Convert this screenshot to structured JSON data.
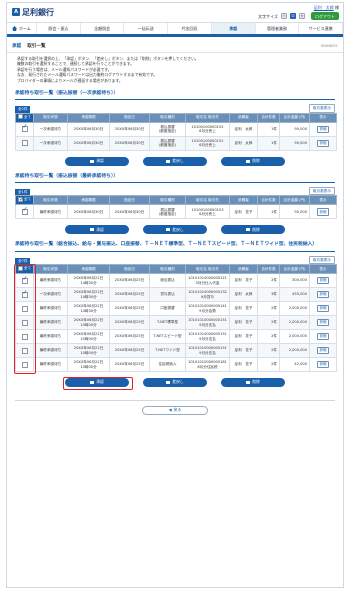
{
  "header": {
    "logo": "足利銀行",
    "user_prefix": "",
    "user_name": "足利　太郎",
    "user_suffix": "様",
    "last_login": "",
    "font_size_label": "文字サイズ",
    "font_size_options": [
      "小",
      "中",
      "大"
    ],
    "logout": "ログアウト"
  },
  "nav": {
    "home": "ホーム",
    "items": [
      "照会・振込",
      "全額照会",
      "一括伝送",
      "代金回収",
      "承認",
      "管理者業務",
      "サービス連携"
    ]
  },
  "page": {
    "title_section": "承認",
    "title": "取引一覧",
    "code": "BSHN001",
    "description": [
      "承認する取引を選択の上、「承認」ボタン、「差戻し」ボタン、または「削除」ボタンを押してください。",
      "複数の取引を選択することで、連続して承認を行うことができます。",
      "承認を行う場合は、メール通知パスワードが必要です。",
      "なお、発行されたメール通知パスワードは出力後約ログアウトするまで有効です。",
      "プロバイダーの事情によりメールが遅延する場合があります。"
    ]
  },
  "section1": {
    "title": "承認待ち取引一覧（振込振替（一次承認待ち））",
    "count": "全2件",
    "col_button": "取引数表示",
    "headers": [
      "全て",
      "取引状態",
      "承認期限",
      "指定日",
      "取引種別",
      "取引名\n取引先",
      "依頼者",
      "合計件数",
      "合計金額\n(円)",
      "表示"
    ],
    "rows": [
      {
        "checked": true,
        "status": "一次承認待ち",
        "deadline": "20XX年06月30日",
        "date": "20XX年06月30日",
        "type": "振込振替\n(都度指定)",
        "name": "10100100000152\n6月分売上",
        "requester": "足利　太郎",
        "count": "1件",
        "amount": "90,000",
        "detail": "詳細"
      },
      {
        "checked": false,
        "status": "一次承認待ち",
        "deadline": "20XX年06月30日",
        "date": "20XX年06月30日",
        "type": "振込振替\n(都度指定)",
        "name": "10100100000152\n6月分売上",
        "requester": "足利　太郎",
        "count": "1件",
        "amount": "90,000",
        "detail": "詳細"
      }
    ],
    "buttons": [
      "承認",
      "差戻し",
      "削除"
    ]
  },
  "section2": {
    "title": "承認待ち取引一覧（振込振替（最終承認待ち））",
    "count": "全1件",
    "col_button": "取引数表示",
    "headers": [
      "全て",
      "取引状態",
      "承認期限",
      "指定日",
      "取引種別",
      "取引名\n取引先",
      "依頼者",
      "合計件数",
      "合計金額\n(円)",
      "表示"
    ],
    "rows": [
      {
        "checked": true,
        "status": "最終承認待ち",
        "deadline": "20XX年06月30日",
        "date": "20XX年06月30日",
        "type": "振込振替\n(都度指定)",
        "name": "10100100000153\n6月分売上",
        "requester": "足利　花子",
        "count": "1件",
        "amount": "90,000",
        "detail": "詳細"
      }
    ],
    "buttons": [
      "承認",
      "差戻し",
      "削除"
    ]
  },
  "section3": {
    "title": "承認待ち取引一覧（総合振込、給与・賞与振込、口座振替、Ｔ－ＮＥＴ標準型、Ｔ－ＮＥＴスピード型、Ｔ－ＮＥＴワイド型、住民税納入）",
    "count": "全7件",
    "col_button": "取引数表示",
    "headers": [
      "全て",
      "取引状態",
      "承認期限",
      "指定日",
      "取引種別",
      "取引名\n取引先",
      "依頼者",
      "合計件数",
      "合計金額\n(円)",
      "表示"
    ],
    "rows": [
      {
        "checked": true,
        "status": "最終承認待ち",
        "deadline": "20XX年06月22日\n14時30分",
        "date": "20XX年06月25日",
        "type": "総合振込",
        "name": "10101010000000121\n5月分仕入代金",
        "requester": "足利　花子",
        "count": "2件",
        "amount": "300,000",
        "detail": "詳細"
      },
      {
        "checked": true,
        "status": "一次承認待ち",
        "deadline": "20XX年06月22日\n14時30分",
        "date": "20XX年06月25日",
        "type": "賞与振込",
        "name": "10101010000000132\n9月賞与",
        "requester": "足利　太郎",
        "count": "3件",
        "amount": "450,000",
        "detail": "詳細"
      },
      {
        "checked": false,
        "status": "最終承認待ち",
        "deadline": "20XX年06月22日\n14時30分",
        "date": "20XX年06月25日",
        "type": "口座振替",
        "name": "10101010000000141\n9月分会費",
        "requester": "足利　花子",
        "count": "2件",
        "amount": "2,000,000",
        "detail": "詳細"
      },
      {
        "checked": false,
        "status": "最終承認待ち",
        "deadline": "20XX年06月22日\n10時00分",
        "date": "20XX年06月25日",
        "type": "T-NET標準型",
        "name": "10101010000000151\n9月分支払",
        "requester": "足利　花子",
        "count": "2件",
        "amount": "2,000,000",
        "detail": "詳細"
      },
      {
        "checked": false,
        "status": "最終承認待ち",
        "deadline": "20XX年06月22日\n10時00分",
        "date": "20XX年06月25日",
        "type": "T-NETスピード型",
        "name": "10101010000000151\n9月分支払",
        "requester": "足利　花子",
        "count": "2件",
        "amount": "2,000,000",
        "detail": "詳細"
      },
      {
        "checked": false,
        "status": "最終承認待ち",
        "deadline": "20XX年06月22日\n10時00分",
        "date": "20XX年06月25日",
        "type": "T-NETワイド型",
        "name": "10101010000000151\n9月分支払",
        "requester": "足利　花子",
        "count": "2件",
        "amount": "2,000,000",
        "detail": "詳細"
      },
      {
        "checked": false,
        "status": "最終承認待ち",
        "deadline": "20XX年06月22日\n10時00分",
        "date": "20XX年06月25日",
        "type": "住民税納入",
        "name": "10101010000000181\n6月分住民税",
        "requester": "足利　花子",
        "count": "2件",
        "amount": "42,000",
        "detail": "詳細"
      }
    ],
    "buttons": [
      "承認",
      "差戻し",
      "削除"
    ]
  },
  "footer": {
    "back": "戻る"
  },
  "colors": {
    "primary": "#1a5faa",
    "header_bg": "#6a8fb8",
    "logout": "#2e9a3c",
    "highlight": "#e0232a"
  }
}
